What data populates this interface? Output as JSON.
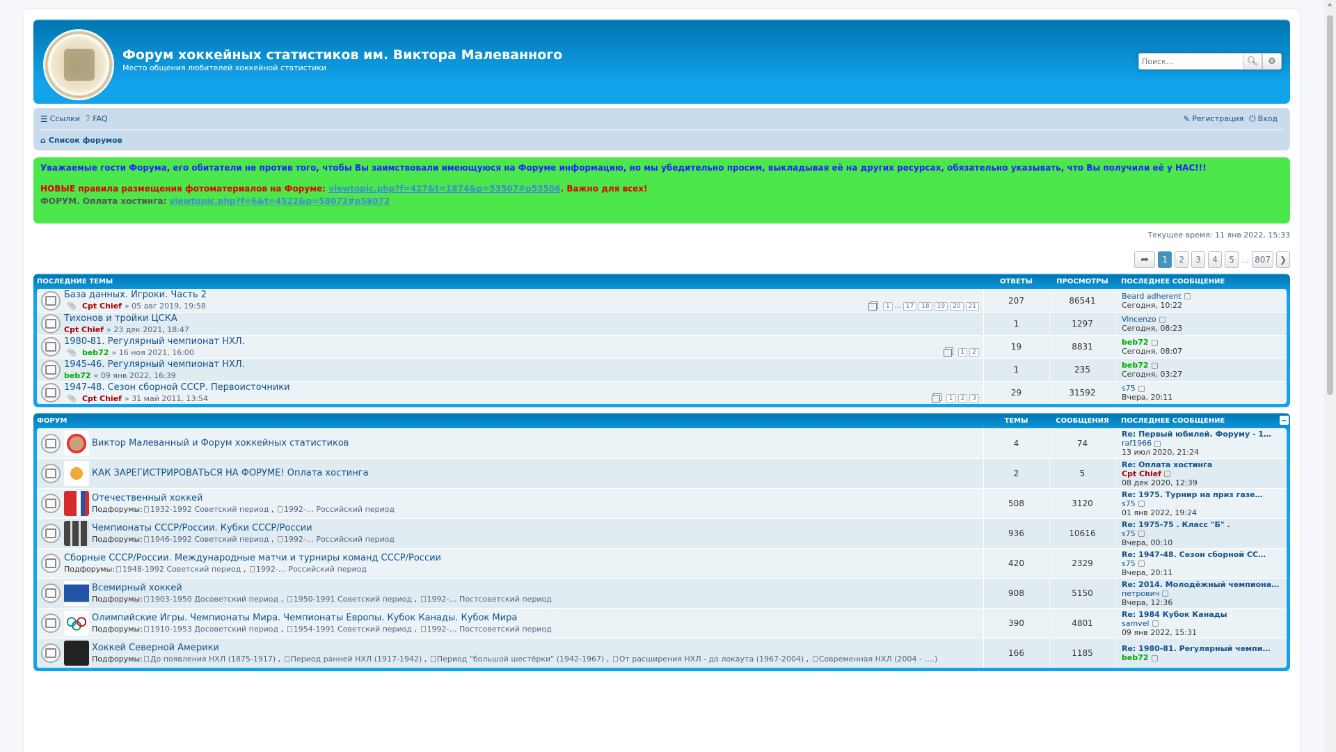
{
  "header": {
    "title": "Форум хоккейных статистиков им. Виктора Малеванного",
    "description": "Место общения любителей хоккейной статистики",
    "search_placeholder": "Поиск…"
  },
  "nav": {
    "links_label": "Ссылки",
    "faq_label": "FAQ",
    "register_label": "Регистрация",
    "login_label": "Вход",
    "breadcrumb": "Список форумов"
  },
  "notice": {
    "line1": "Уважаемые гости Форума, его обитатели не против того, чтобы Вы заимствовали имеющуюся на Форуме информацию, но мы убедительно просим, выкладывая её на других ресурсах, обязательно указывать, что Вы получили её у НАС!!!",
    "line2_prefix": "НОВЫЕ правила размещения фотоматериалов на Форуме: ",
    "line2_link": "viewtopic.php?f=427&t=1874&p=53507#p53506",
    "line2_suffix": ". Важно для всех!",
    "line3_prefix": "ФОРУМ. Оплата хостинга: ",
    "line3_link": "viewtopic.php?f=6&t=4522&p=58072#p58072"
  },
  "current_time": "Текущее время: 11 янв 2022, 15:33",
  "pagination": [
    "1",
    "2",
    "3",
    "4",
    "5",
    "…",
    "807"
  ],
  "recent": {
    "header": {
      "title": "ПОСЛЕДНИЕ ТЕМЫ",
      "col_a": "ОТВЕТЫ",
      "col_b": "ПРОСМОТРЫ",
      "col_c": "ПОСЛЕДНЕЕ СООБЩЕНИЕ"
    },
    "topics": [
      {
        "title": "База данных. Игроки. Часть 2",
        "author": "Cpt Chief",
        "date": "» 05 авг 2019, 19:58",
        "replies": "207",
        "views": "86541",
        "last_user": "Beard adherent",
        "last_time": "Сегодня, 10:22",
        "pages": [
          "1",
          "…",
          "17",
          "18",
          "19",
          "20",
          "21"
        ]
      },
      {
        "title": "Тихонов и тройки ЦСКА",
        "author": "Cpt Chief",
        "date": "» 23 дек 2021, 18:47",
        "replies": "1",
        "views": "1297",
        "last_user": "Vincenzo",
        "last_time": "Сегодня, 08:23",
        "pages": []
      },
      {
        "title": "1980-81. Регулярный чемпионат НХЛ.",
        "author": "beb72",
        "date": "» 16 ноя 2021, 16:00",
        "replies": "19",
        "views": "8831",
        "last_user": "beb72",
        "last_time": "Сегодня, 08:07",
        "pages": [
          "1",
          "2"
        ]
      },
      {
        "title": "1945-46. Регулярный чемпионат НХЛ.",
        "author": "beb72",
        "date": "» 09 янв 2022, 16:39",
        "replies": "1",
        "views": "235",
        "last_user": "beb72",
        "last_time": "Сегодня, 03:27",
        "pages": []
      },
      {
        "title": "1947-48. Сезон сборной СССР. Первоисточники",
        "author": "Cpt Chief",
        "date": "» 31 май 2011, 13:54",
        "replies": "29",
        "views": "31592",
        "last_user": "s75",
        "last_time": "Вчера, 20:11",
        "pages": [
          "1",
          "2",
          "3"
        ]
      }
    ]
  },
  "forums": {
    "header": {
      "title": "ФОРУМ",
      "col_a": "ТЕМЫ",
      "col_b": "СООБЩЕНИЯ",
      "col_c": "ПОСЛЕДНЕЕ СООБЩЕНИЕ"
    },
    "subforums_label": "Подфорумы:",
    "items": [
      {
        "title": "Виктор Малеванный и Форум хоккейных статистиков",
        "subforums": [],
        "topics": "4",
        "posts": "74",
        "last_title": "Re: Первый юбилей. Форуму - 1…",
        "last_user": "raf1966",
        "last_time": "13 июл 2020, 21:24"
      },
      {
        "title": "КАК ЗАРЕГИСТРИРОВАТЬСЯ НА ФОРУМЕ! Оплата хостинга",
        "subforums": [],
        "topics": "2",
        "posts": "5",
        "last_title": "Re: Оплата хостинга",
        "last_user": "Cpt Chief",
        "last_time": "08 дек 2020, 12:39"
      },
      {
        "title": "Отечественный хоккей",
        "subforums": [
          "1932-1992 Советский период",
          "1992-… Российский период"
        ],
        "topics": "508",
        "posts": "3120",
        "last_title": "Re: 1975. Турнир на приз газе…",
        "last_user": "s75",
        "last_time": "01 янв 2022, 19:24"
      },
      {
        "title": "Чемпионаты СССР/России. Кубки СССР/России",
        "subforums": [
          "1946-1992 Советский период",
          "1992-… Российский период"
        ],
        "topics": "936",
        "posts": "10616",
        "last_title": "Re: 1975-75 . Класс \"Б\" .",
        "last_user": "s75",
        "last_time": "Вчера, 00:10"
      },
      {
        "title": "Сборные СССР/России. Международные матчи и турниры команд СССР/России",
        "subforums": [
          "1948-1992 Советский период",
          "1992-… Российский период"
        ],
        "topics": "420",
        "posts": "2329",
        "last_title": "Re: 1947-48. Сезон сборной СС…",
        "last_user": "s75",
        "last_time": "Вчера, 20:11"
      },
      {
        "title": "Всемирный хоккей",
        "subforums": [
          "1903-1950 Досоветский период",
          "1950-1991 Советский период",
          "1992-… Постсоветский период"
        ],
        "topics": "908",
        "posts": "5150",
        "last_title": "Re: 2014. Молодёжный чемпиона…",
        "last_user": "петрович",
        "last_time": "Вчера, 12:36"
      },
      {
        "title": "Олимпийские Игры. Чемпионаты Мира. Чемпионаты Европы. Кубок Канады. Кубок Мира",
        "subforums": [
          "1910-1953 Досоветский период",
          "1954-1991 Советский период",
          "1992-… Постсоветский период"
        ],
        "topics": "390",
        "posts": "4801",
        "last_title": "Re: 1984 Кубок Канады",
        "last_user": "samvel",
        "last_time": "09 янв 2022, 15:31"
      },
      {
        "title": "Хоккей Северной Америки",
        "subforums": [
          "До появления НХЛ (1875-1917)",
          "Период ранней НХЛ (1917-1942)",
          "Период \"большой шестёрки\" (1942-1967)",
          "От расширения НХЛ - до локаута (1967-2004)",
          "Современная НХЛ (2004 - ….)"
        ],
        "topics": "166",
        "posts": "1185",
        "last_title": "Re: 1980-81. Регулярный чемпи…",
        "last_user": "beb72",
        "last_time": ""
      }
    ]
  }
}
